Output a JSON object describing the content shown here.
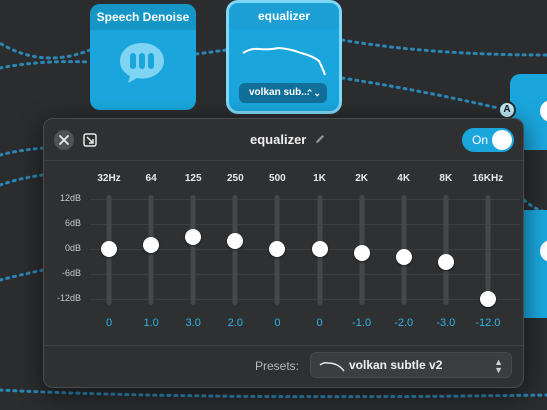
{
  "nodes": {
    "denoise": {
      "title": "Speech Denoise",
      "icon": "speech-bubble-waveform-icon"
    },
    "equalizer": {
      "title": "equalizer",
      "preset_short": "volkan sub..."
    },
    "badge": "A"
  },
  "panel": {
    "title": "equalizer",
    "toggle_label": "On",
    "toggle_on": true,
    "frequencies": [
      "32Hz",
      "64",
      "125",
      "250",
      "500",
      "1K",
      "2K",
      "4K",
      "8K",
      "16KHz"
    ],
    "db_scale": [
      "12dB",
      "6dB",
      "0dB",
      "-6dB",
      "-12dB"
    ],
    "gains": [
      0,
      1.0,
      3.0,
      2.0,
      0,
      0,
      -1.0,
      -2.0,
      -3.0,
      -12.0
    ],
    "gain_labels": [
      "0",
      "1.0",
      "3.0",
      "2.0",
      "0",
      "0",
      "-1.0",
      "-2.0",
      "-3.0",
      "-12.0"
    ],
    "presets_label": "Presets:",
    "preset_name": "volkan subtle v2"
  },
  "colors": {
    "accent": "#1aa6dc",
    "background": "#2b2c2e",
    "panel": "#2f3032",
    "gain_text": "#2fb6ea"
  }
}
